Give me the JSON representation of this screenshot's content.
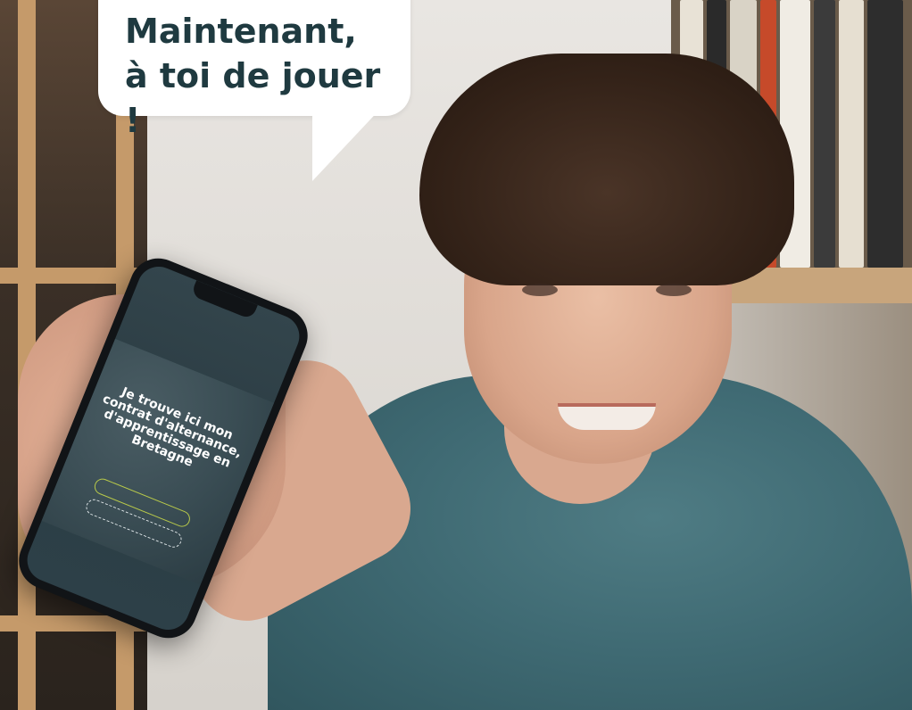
{
  "speech_bubble": {
    "line1": "Maintenant,",
    "line2": "à toi de jouer !"
  },
  "phone_screen": {
    "url_text": "",
    "headline": "Je trouve ici mon contrat d'alternance, d'apprentissage en Bretagne",
    "subline": "",
    "primary_button": "",
    "secondary_button": ""
  },
  "colors": {
    "bubble_text": "#1f3a40",
    "bubble_bg": "#ffffff",
    "shirt": "#3f6a73",
    "screen_bg": "#2b3c43",
    "accent_button": "#b8c94a"
  }
}
